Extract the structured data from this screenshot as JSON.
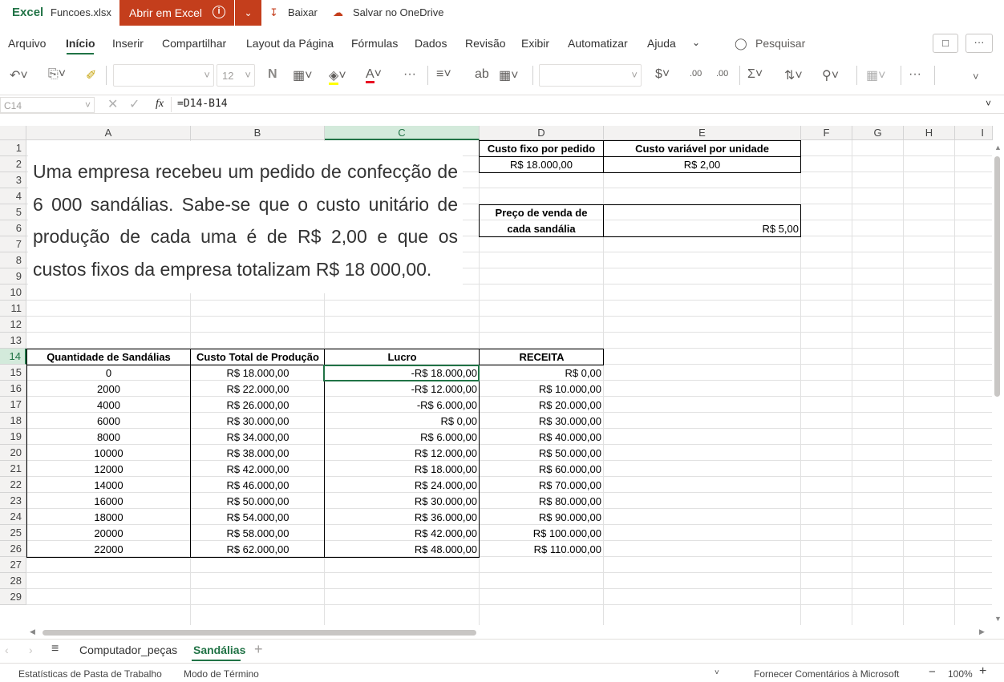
{
  "app": {
    "brand": "Excel",
    "filename": "Funcoes.xlsx",
    "open_button": "Abrir em Excel",
    "download": "Baixar",
    "save_onedrive": "Salvar no OneDrive"
  },
  "menu": [
    "Arquivo",
    "Início",
    "Inserir",
    "Compartilhar",
    "Layout da Página",
    "Fórmulas",
    "Dados",
    "Revisão",
    "Exibir",
    "Automatizar",
    "Ajuda"
  ],
  "search": "Pesquisar",
  "toolbar": {
    "font_size": "12",
    "bold": "N"
  },
  "formula_bar": {
    "cell_ref": "C14",
    "fx": "fx",
    "formula": "=D14-B14"
  },
  "columns": [
    "A",
    "B",
    "C",
    "D",
    "E",
    "F",
    "G",
    "H",
    "I"
  ],
  "rows": [
    "1",
    "2",
    "3",
    "4",
    "5",
    "6",
    "7",
    "8",
    "9",
    "10",
    "11",
    "12",
    "13",
    "14",
    "15",
    "16",
    "17",
    "18",
    "19",
    "20",
    "21",
    "22",
    "23",
    "24",
    "25",
    "26",
    "27",
    "28",
    "29"
  ],
  "textbox": "Uma empresa recebeu um pedido de confecção de 6 000 sandálias. Sabe-se que o custo unitário de produção de cada uma é de R$ 2,00 e que os custos fixos da empresa totalizam R$ 18 000,00.",
  "params": {
    "d1": "Custo fixo por pedido",
    "e1": "Custo variável por unidade",
    "d2": "R$ 18.000,00",
    "e2": "R$ 2,00",
    "d5": "Preço de venda de cada sandália",
    "e5": "R$ 5,00"
  },
  "table": {
    "headers": [
      "Quantidade de Sandálias",
      "Custo Total de Produção",
      "Lucro",
      "RECEITA"
    ],
    "rows": [
      [
        "0",
        "R$ 18.000,00",
        "-R$ 18.000,00",
        "R$ 0,00"
      ],
      [
        "2000",
        "R$ 22.000,00",
        "-R$ 12.000,00",
        "R$ 10.000,00"
      ],
      [
        "4000",
        "R$ 26.000,00",
        "-R$ 6.000,00",
        "R$ 20.000,00"
      ],
      [
        "6000",
        "R$ 30.000,00",
        "R$ 0,00",
        "R$ 30.000,00"
      ],
      [
        "8000",
        "R$ 34.000,00",
        "R$ 6.000,00",
        "R$ 40.000,00"
      ],
      [
        "10000",
        "R$ 38.000,00",
        "R$ 12.000,00",
        "R$ 50.000,00"
      ],
      [
        "12000",
        "R$ 42.000,00",
        "R$ 18.000,00",
        "R$ 60.000,00"
      ],
      [
        "14000",
        "R$ 46.000,00",
        "R$ 24.000,00",
        "R$ 70.000,00"
      ],
      [
        "16000",
        "R$ 50.000,00",
        "R$ 30.000,00",
        "R$ 80.000,00"
      ],
      [
        "18000",
        "R$ 54.000,00",
        "R$ 36.000,00",
        "R$ 90.000,00"
      ],
      [
        "20000",
        "R$ 58.000,00",
        "R$ 42.000,00",
        "R$ 100.000,00"
      ],
      [
        "22000",
        "R$ 62.000,00",
        "R$ 48.000,00",
        "R$ 110.000,00"
      ]
    ]
  },
  "sheets": [
    "Computador_peças",
    "Sandálias"
  ],
  "status": {
    "stats": "Estatísticas de Pasta de Trabalho",
    "mode": "Modo de Término",
    "feedback": "Fornecer Comentários à Microsoft",
    "zoom": "100%"
  },
  "colors": {
    "accent": "#217346",
    "open_button": "#c43e1c"
  }
}
